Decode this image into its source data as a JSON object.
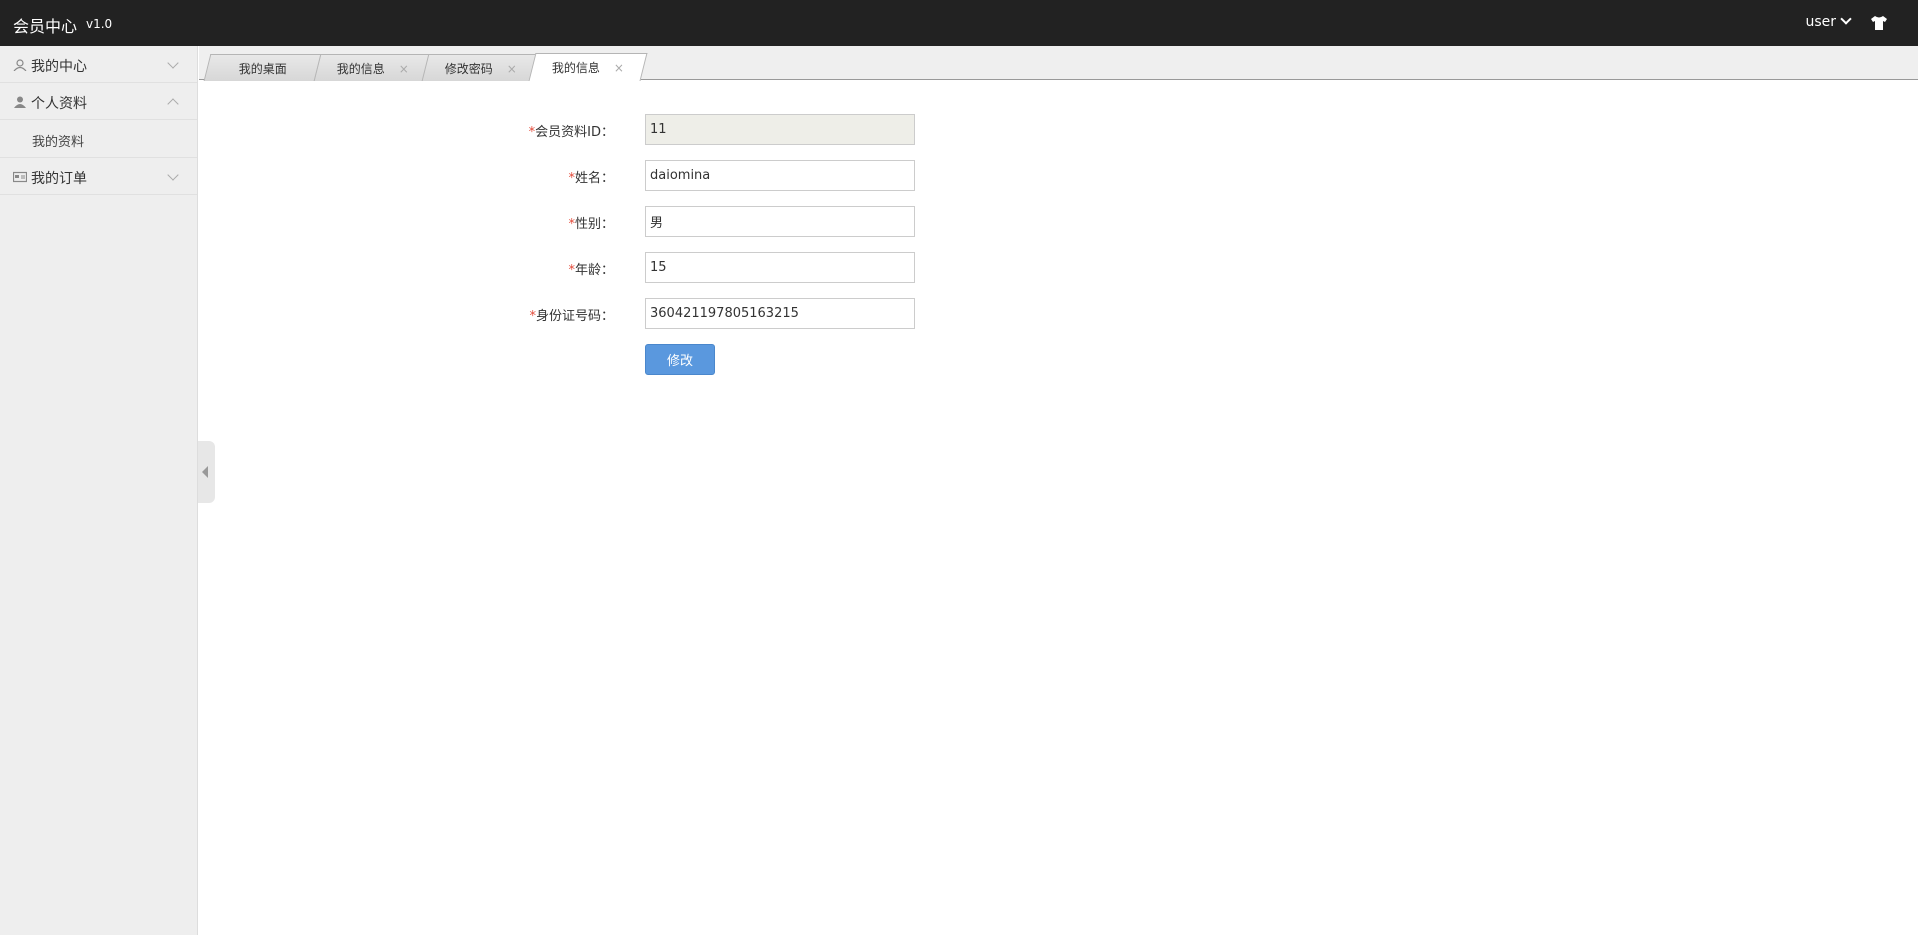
{
  "header": {
    "app_title": "会员中心",
    "version": "v1.0",
    "user_label": "user"
  },
  "sidebar": {
    "items": [
      {
        "label": "我的中心",
        "icon": "user-outline-icon",
        "expanded": false
      },
      {
        "label": "个人资料",
        "icon": "user-filled-icon",
        "expanded": true,
        "children": [
          {
            "label": "我的资料"
          }
        ]
      },
      {
        "label": "我的订单",
        "icon": "card-icon",
        "expanded": false
      }
    ]
  },
  "tabs": [
    {
      "label": "我的桌面",
      "closable": false,
      "active": false
    },
    {
      "label": "我的信息",
      "closable": true,
      "active": false
    },
    {
      "label": "修改密码",
      "closable": true,
      "active": false
    },
    {
      "label": "我的信息",
      "closable": true,
      "active": true
    }
  ],
  "form": {
    "fields": [
      {
        "label": "会员资料ID：",
        "value": "11",
        "readonly": true
      },
      {
        "label": "姓名：",
        "value": "daiomina",
        "readonly": false
      },
      {
        "label": "性别：",
        "value": "男",
        "readonly": false
      },
      {
        "label": "年龄：",
        "value": "15",
        "readonly": false
      },
      {
        "label": "身份证号码：",
        "value": "360421197805163215",
        "readonly": false
      }
    ],
    "required_mark": "*",
    "submit_label": "修改"
  },
  "colors": {
    "topbar_bg": "#222222",
    "sidebar_bg": "#eeeeee",
    "button_bg": "#5a98de",
    "required_mark": "#e34a3a"
  }
}
